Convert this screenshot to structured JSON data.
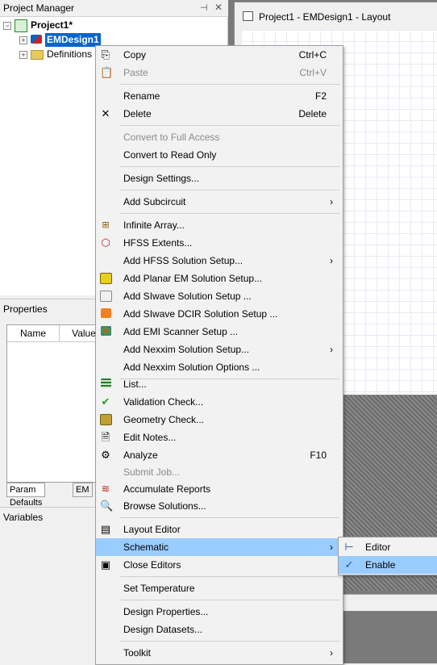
{
  "project_manager": {
    "title": "Project Manager",
    "tree": {
      "root": "Project1*",
      "design": "EMDesign1",
      "definitions": "Definitions"
    }
  },
  "properties": {
    "title": "Properties",
    "columns": [
      "Name",
      "Value"
    ],
    "tabs": [
      "Param Defaults",
      "EM"
    ]
  },
  "variables": {
    "title": "Variables"
  },
  "layout_window": {
    "title": "Project1 - EMDesign1 - Layout"
  },
  "context_menu": {
    "items": [
      {
        "label": "Copy",
        "shortcut": "Ctrl+C"
      },
      {
        "label": "Paste",
        "shortcut": "Ctrl+V"
      },
      {
        "label": "Rename",
        "shortcut": "F2"
      },
      {
        "label": "Delete",
        "shortcut": "Delete"
      },
      {
        "label": "Convert to Full Access"
      },
      {
        "label": "Convert to Read Only"
      },
      {
        "label": "Design Settings..."
      },
      {
        "label": "Add Subcircuit",
        "arrow": "›"
      },
      {
        "label": "Infinite Array..."
      },
      {
        "label": "HFSS Extents..."
      },
      {
        "label": "Add HFSS Solution Setup...",
        "arrow": "›"
      },
      {
        "label": "Add Planar EM Solution Setup..."
      },
      {
        "label": "Add SIwave Solution Setup ..."
      },
      {
        "label": "Add SIwave DCIR Solution Setup ..."
      },
      {
        "label": "Add EMI Scanner Setup ..."
      },
      {
        "label": "Add Nexxim Solution Setup...",
        "arrow": "›"
      },
      {
        "label": "Add Nexxim Solution Options ..."
      },
      {
        "label": "List..."
      },
      {
        "label": "Validation Check..."
      },
      {
        "label": "Geometry Check..."
      },
      {
        "label": "Edit Notes..."
      },
      {
        "label": "Analyze",
        "shortcut": "F10"
      },
      {
        "label": "Submit Job..."
      },
      {
        "label": "Accumulate Reports"
      },
      {
        "label": "Browse Solutions..."
      },
      {
        "label": "Layout Editor"
      },
      {
        "label": "Schematic",
        "arrow": "›"
      },
      {
        "label": "Close Editors"
      },
      {
        "label": "Set Temperature"
      },
      {
        "label": "Design Properties..."
      },
      {
        "label": "Design Datasets..."
      },
      {
        "label": "Toolkit",
        "arrow": "›"
      }
    ]
  },
  "submenu": {
    "items": [
      {
        "label": "Editor"
      },
      {
        "label": "Enable",
        "check": "✓"
      }
    ]
  },
  "colors": {
    "highlight": "#99ccff",
    "selection": "#0a64c8"
  }
}
